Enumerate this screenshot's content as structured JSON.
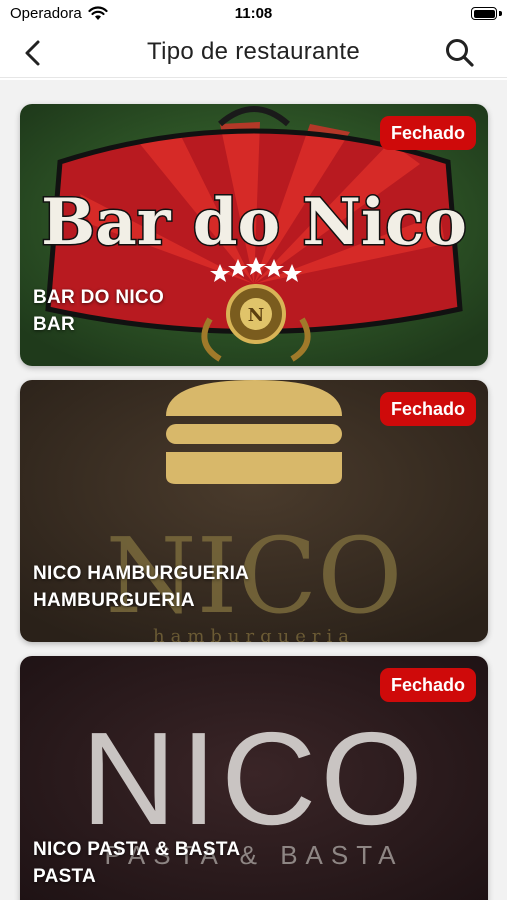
{
  "status_bar": {
    "carrier": "Operadora",
    "time": "11:08",
    "icons": [
      "wifi-icon",
      "battery-icon"
    ]
  },
  "header": {
    "title": "Tipo de restaurante",
    "back_icon": "chevron-left-icon",
    "search_icon": "search-icon"
  },
  "restaurants": [
    {
      "name": "BAR DO NICO",
      "type": "BAR",
      "status": "Fechado",
      "logo_text": "Bar do Nico",
      "logo_emblem": "N"
    },
    {
      "name": "NICO HAMBURGUERIA",
      "type": "HAMBURGUERIA",
      "status": "Fechado",
      "logo_text": "NICO",
      "logo_subtext": "hamburgueria"
    },
    {
      "name": "NICO PASTA & BASTA",
      "type": "PASTA",
      "status": "Fechado",
      "logo_text": "NICO",
      "logo_subtext": "PASTA & BASTA"
    }
  ],
  "colors": {
    "badge": "#cf0a0a",
    "bar_green": "#2f5a2a",
    "bar_red": "#c01a20",
    "burger_gold": "#d9b86a",
    "card2_bg": "#3a2d22",
    "card3_bg": "#2a1a1c"
  }
}
